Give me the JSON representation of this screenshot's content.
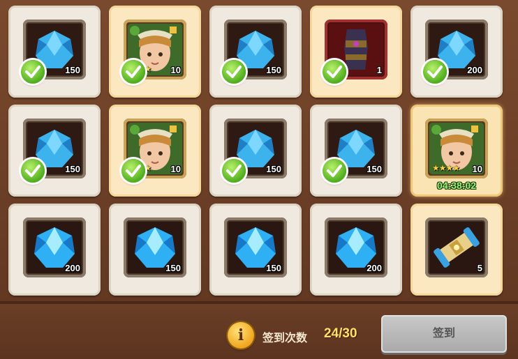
{
  "colors": {
    "gem": "#3db3ee",
    "check": "#5dbf1f",
    "timer": "#9cf07a",
    "count": "#ffe06a"
  },
  "rewards": [
    {
      "item": "gem",
      "qty": "150",
      "claimed": true
    },
    {
      "item": "hero",
      "qty": "10",
      "claimed": true
    },
    {
      "item": "gem",
      "qty": "150",
      "claimed": true
    },
    {
      "item": "armor-bracer",
      "qty": "1",
      "claimed": true
    },
    {
      "item": "gem",
      "qty": "200",
      "claimed": true
    },
    {
      "item": "gem",
      "qty": "150",
      "claimed": true
    },
    {
      "item": "hero",
      "qty": "10",
      "claimed": true
    },
    {
      "item": "gem",
      "qty": "150",
      "claimed": true
    },
    {
      "item": "gem",
      "qty": "150",
      "claimed": true
    },
    {
      "item": "hero",
      "qty": "10",
      "claimed": false,
      "timer": "04:38:02"
    },
    {
      "item": "gem",
      "qty": "200",
      "claimed": false
    },
    {
      "item": "gem",
      "qty": "150",
      "claimed": false
    },
    {
      "item": "gem",
      "qty": "150",
      "claimed": false
    },
    {
      "item": "gem",
      "qty": "200",
      "claimed": false
    },
    {
      "item": "scroll",
      "qty": "5",
      "claimed": false
    }
  ],
  "footer": {
    "info_icon": "i",
    "count_label": "签到次数",
    "count_value": "24/30",
    "signin_label": "签到"
  }
}
